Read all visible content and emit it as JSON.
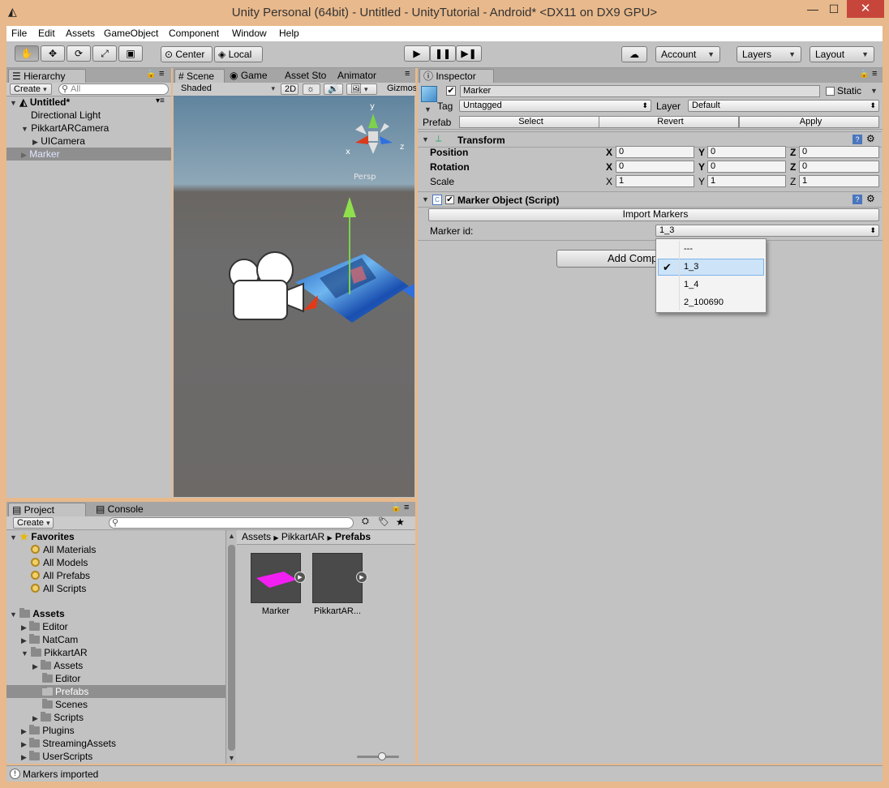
{
  "window": {
    "title": "Unity Personal (64bit) - Untitled - UnityTutorial - Android* <DX11 on DX9 GPU>",
    "minimize": "—",
    "maximize": "☐",
    "close": "✕"
  },
  "menu": [
    "File",
    "Edit",
    "Assets",
    "GameObject",
    "Component",
    "Window",
    "Help"
  ],
  "toolbar": {
    "center": "Center",
    "local": "Local",
    "account": "Account",
    "layers": "Layers",
    "layout": "Layout"
  },
  "hierarchy": {
    "tab": "Hierarchy",
    "create": "Create",
    "search_placeholder": "All",
    "scene": "Untitled*",
    "items": [
      "Directional Light",
      "PikkartARCamera",
      "UICamera",
      "Marker"
    ]
  },
  "scene_view": {
    "tabs": [
      "Scene",
      "Game",
      "Asset Sto",
      "Animator"
    ],
    "shading": "Shaded",
    "mode_2d": "2D",
    "gizmos": "Gizmos",
    "persp": "Persp",
    "axes": {
      "x": "x",
      "y": "y",
      "z": "z"
    }
  },
  "inspector": {
    "tab": "Inspector",
    "object_name": "Marker",
    "static_label": "Static",
    "tag_label": "Tag",
    "tag_value": "Untagged",
    "layer_label": "Layer",
    "layer_value": "Default",
    "prefab_label": "Prefab",
    "prefab_select": "Select",
    "prefab_revert": "Revert",
    "prefab_apply": "Apply",
    "transform": {
      "title": "Transform",
      "position_label": "Position",
      "rotation_label": "Rotation",
      "scale_label": "Scale",
      "position": {
        "x": "0",
        "y": "0",
        "z": "0"
      },
      "rotation": {
        "x": "0",
        "y": "0",
        "z": "0"
      },
      "scale": {
        "x": "1",
        "y": "1",
        "z": "1"
      }
    },
    "script": {
      "title": "Marker Object (Script)",
      "import_button": "Import Markers",
      "marker_id_label": "Marker id:",
      "marker_id_value": "1_3"
    },
    "add_component": "Add Component",
    "dropdown_options": [
      "---",
      "1_3",
      "1_4",
      "2_100690"
    ],
    "dropdown_selected": "1_3"
  },
  "project": {
    "tab": "Project",
    "console_tab": "Console",
    "create": "Create",
    "favorites_label": "Favorites",
    "favorites": [
      "All Materials",
      "All Models",
      "All Prefabs",
      "All Scripts"
    ],
    "assets_label": "Assets",
    "folders": [
      "Editor",
      "NatCam",
      "PikkartAR",
      "Assets",
      "Editor",
      "Prefabs",
      "Scenes",
      "Scripts",
      "Plugins",
      "StreamingAssets",
      "UserScripts"
    ],
    "breadcrumb": [
      "Assets",
      "PikkartAR",
      "Prefabs"
    ],
    "assets": [
      "Marker",
      "PikkartAR..."
    ]
  },
  "status": "Markers imported"
}
